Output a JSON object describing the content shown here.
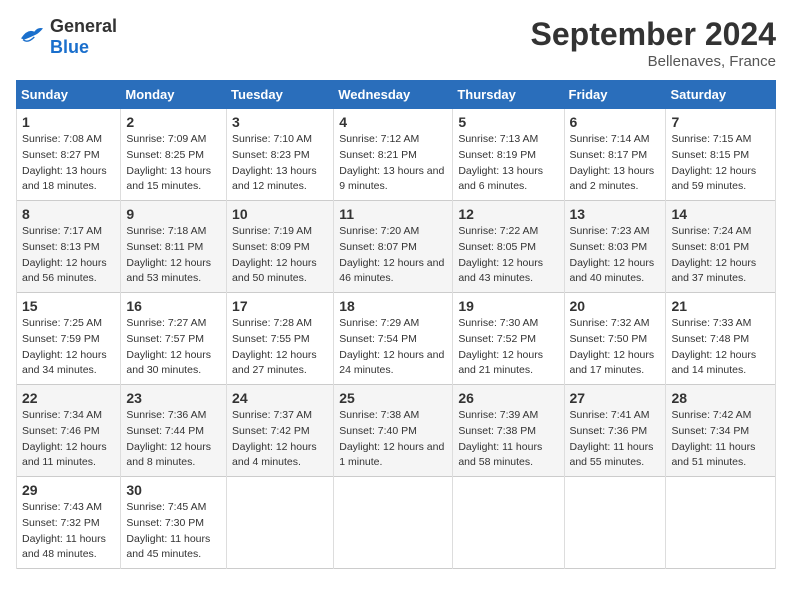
{
  "header": {
    "logo": {
      "general": "General",
      "blue": "Blue"
    },
    "title": "September 2024",
    "subtitle": "Bellenaves, France"
  },
  "columns": [
    "Sunday",
    "Monday",
    "Tuesday",
    "Wednesday",
    "Thursday",
    "Friday",
    "Saturday"
  ],
  "weeks": [
    [
      {
        "day": "1",
        "sunrise": "Sunrise: 7:08 AM",
        "sunset": "Sunset: 8:27 PM",
        "daylight": "Daylight: 13 hours and 18 minutes."
      },
      {
        "day": "2",
        "sunrise": "Sunrise: 7:09 AM",
        "sunset": "Sunset: 8:25 PM",
        "daylight": "Daylight: 13 hours and 15 minutes."
      },
      {
        "day": "3",
        "sunrise": "Sunrise: 7:10 AM",
        "sunset": "Sunset: 8:23 PM",
        "daylight": "Daylight: 13 hours and 12 minutes."
      },
      {
        "day": "4",
        "sunrise": "Sunrise: 7:12 AM",
        "sunset": "Sunset: 8:21 PM",
        "daylight": "Daylight: 13 hours and 9 minutes."
      },
      {
        "day": "5",
        "sunrise": "Sunrise: 7:13 AM",
        "sunset": "Sunset: 8:19 PM",
        "daylight": "Daylight: 13 hours and 6 minutes."
      },
      {
        "day": "6",
        "sunrise": "Sunrise: 7:14 AM",
        "sunset": "Sunset: 8:17 PM",
        "daylight": "Daylight: 13 hours and 2 minutes."
      },
      {
        "day": "7",
        "sunrise": "Sunrise: 7:15 AM",
        "sunset": "Sunset: 8:15 PM",
        "daylight": "Daylight: 12 hours and 59 minutes."
      }
    ],
    [
      {
        "day": "8",
        "sunrise": "Sunrise: 7:17 AM",
        "sunset": "Sunset: 8:13 PM",
        "daylight": "Daylight: 12 hours and 56 minutes."
      },
      {
        "day": "9",
        "sunrise": "Sunrise: 7:18 AM",
        "sunset": "Sunset: 8:11 PM",
        "daylight": "Daylight: 12 hours and 53 minutes."
      },
      {
        "day": "10",
        "sunrise": "Sunrise: 7:19 AM",
        "sunset": "Sunset: 8:09 PM",
        "daylight": "Daylight: 12 hours and 50 minutes."
      },
      {
        "day": "11",
        "sunrise": "Sunrise: 7:20 AM",
        "sunset": "Sunset: 8:07 PM",
        "daylight": "Daylight: 12 hours and 46 minutes."
      },
      {
        "day": "12",
        "sunrise": "Sunrise: 7:22 AM",
        "sunset": "Sunset: 8:05 PM",
        "daylight": "Daylight: 12 hours and 43 minutes."
      },
      {
        "day": "13",
        "sunrise": "Sunrise: 7:23 AM",
        "sunset": "Sunset: 8:03 PM",
        "daylight": "Daylight: 12 hours and 40 minutes."
      },
      {
        "day": "14",
        "sunrise": "Sunrise: 7:24 AM",
        "sunset": "Sunset: 8:01 PM",
        "daylight": "Daylight: 12 hours and 37 minutes."
      }
    ],
    [
      {
        "day": "15",
        "sunrise": "Sunrise: 7:25 AM",
        "sunset": "Sunset: 7:59 PM",
        "daylight": "Daylight: 12 hours and 34 minutes."
      },
      {
        "day": "16",
        "sunrise": "Sunrise: 7:27 AM",
        "sunset": "Sunset: 7:57 PM",
        "daylight": "Daylight: 12 hours and 30 minutes."
      },
      {
        "day": "17",
        "sunrise": "Sunrise: 7:28 AM",
        "sunset": "Sunset: 7:55 PM",
        "daylight": "Daylight: 12 hours and 27 minutes."
      },
      {
        "day": "18",
        "sunrise": "Sunrise: 7:29 AM",
        "sunset": "Sunset: 7:54 PM",
        "daylight": "Daylight: 12 hours and 24 minutes."
      },
      {
        "day": "19",
        "sunrise": "Sunrise: 7:30 AM",
        "sunset": "Sunset: 7:52 PM",
        "daylight": "Daylight: 12 hours and 21 minutes."
      },
      {
        "day": "20",
        "sunrise": "Sunrise: 7:32 AM",
        "sunset": "Sunset: 7:50 PM",
        "daylight": "Daylight: 12 hours and 17 minutes."
      },
      {
        "day": "21",
        "sunrise": "Sunrise: 7:33 AM",
        "sunset": "Sunset: 7:48 PM",
        "daylight": "Daylight: 12 hours and 14 minutes."
      }
    ],
    [
      {
        "day": "22",
        "sunrise": "Sunrise: 7:34 AM",
        "sunset": "Sunset: 7:46 PM",
        "daylight": "Daylight: 12 hours and 11 minutes."
      },
      {
        "day": "23",
        "sunrise": "Sunrise: 7:36 AM",
        "sunset": "Sunset: 7:44 PM",
        "daylight": "Daylight: 12 hours and 8 minutes."
      },
      {
        "day": "24",
        "sunrise": "Sunrise: 7:37 AM",
        "sunset": "Sunset: 7:42 PM",
        "daylight": "Daylight: 12 hours and 4 minutes."
      },
      {
        "day": "25",
        "sunrise": "Sunrise: 7:38 AM",
        "sunset": "Sunset: 7:40 PM",
        "daylight": "Daylight: 12 hours and 1 minute."
      },
      {
        "day": "26",
        "sunrise": "Sunrise: 7:39 AM",
        "sunset": "Sunset: 7:38 PM",
        "daylight": "Daylight: 11 hours and 58 minutes."
      },
      {
        "day": "27",
        "sunrise": "Sunrise: 7:41 AM",
        "sunset": "Sunset: 7:36 PM",
        "daylight": "Daylight: 11 hours and 55 minutes."
      },
      {
        "day": "28",
        "sunrise": "Sunrise: 7:42 AM",
        "sunset": "Sunset: 7:34 PM",
        "daylight": "Daylight: 11 hours and 51 minutes."
      }
    ],
    [
      {
        "day": "29",
        "sunrise": "Sunrise: 7:43 AM",
        "sunset": "Sunset: 7:32 PM",
        "daylight": "Daylight: 11 hours and 48 minutes."
      },
      {
        "day": "30",
        "sunrise": "Sunrise: 7:45 AM",
        "sunset": "Sunset: 7:30 PM",
        "daylight": "Daylight: 11 hours and 45 minutes."
      },
      {
        "day": "",
        "sunrise": "",
        "sunset": "",
        "daylight": ""
      },
      {
        "day": "",
        "sunrise": "",
        "sunset": "",
        "daylight": ""
      },
      {
        "day": "",
        "sunrise": "",
        "sunset": "",
        "daylight": ""
      },
      {
        "day": "",
        "sunrise": "",
        "sunset": "",
        "daylight": ""
      },
      {
        "day": "",
        "sunrise": "",
        "sunset": "",
        "daylight": ""
      }
    ]
  ]
}
